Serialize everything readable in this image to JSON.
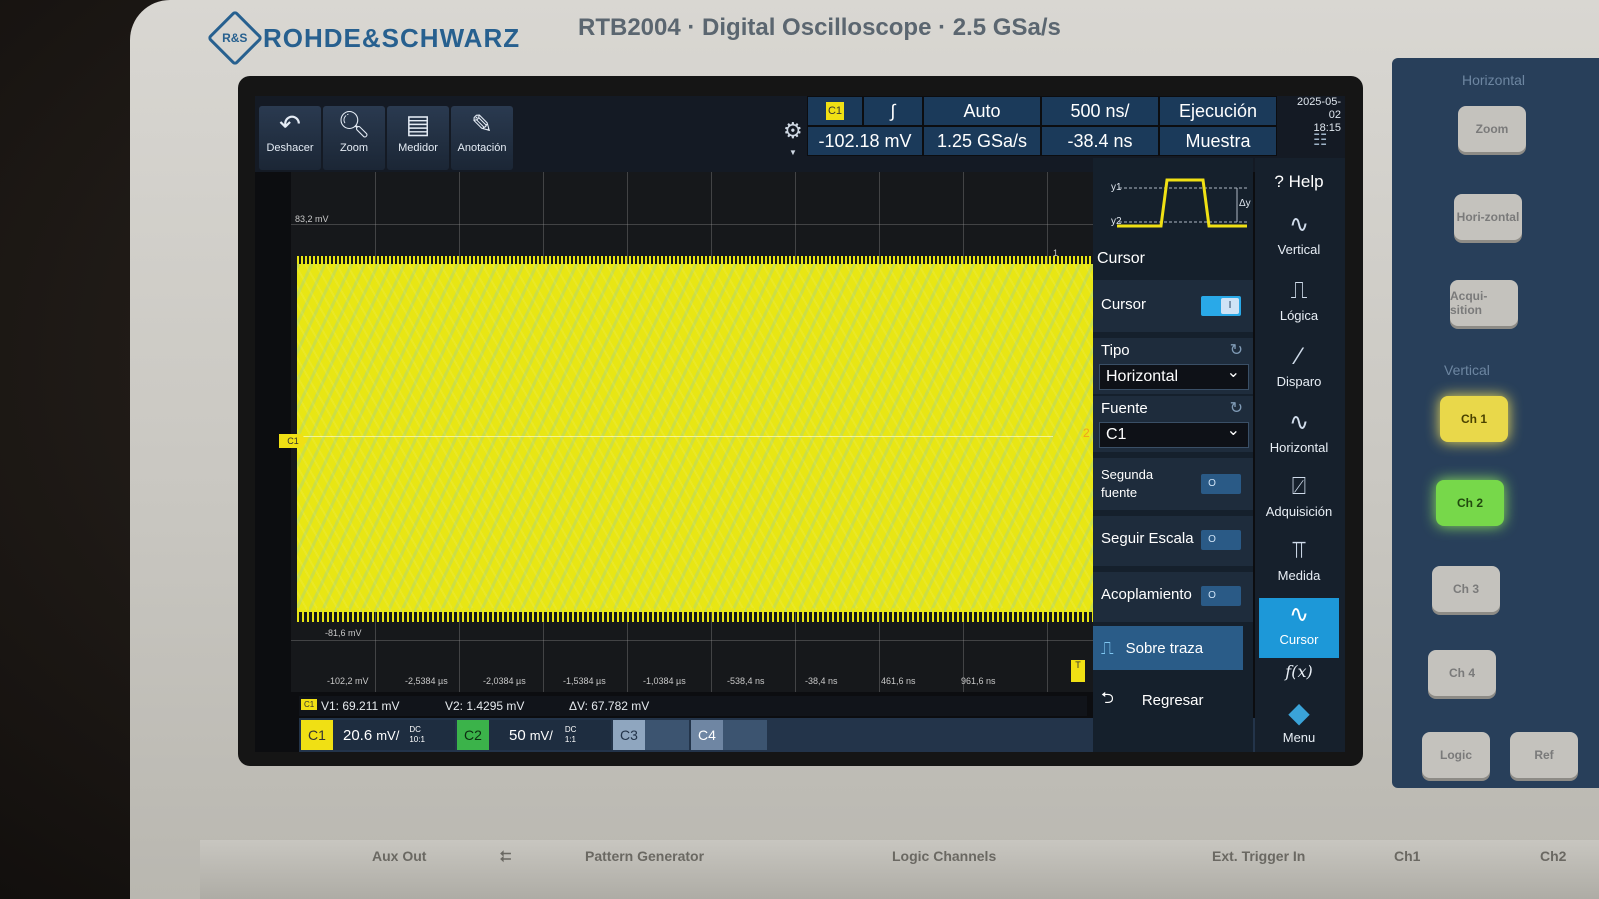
{
  "device": {
    "brand": "ROHDE&SCHWARZ",
    "model": "RTB2004 · Digital Oscilloscope · 2.5 GSa/s"
  },
  "toolbar": {
    "buttons": [
      {
        "label": "Deshacer",
        "icon": "undo-icon"
      },
      {
        "label": "Zoom",
        "icon": "zoom-icon"
      },
      {
        "label": "Medidor",
        "icon": "meter-icon"
      },
      {
        "label": "Anotación",
        "icon": "pencil-icon"
      }
    ]
  },
  "status": {
    "channel": "C1",
    "trigger_level": "-102.18 mV",
    "trigger_mode": "Auto",
    "sample_rate": "1.25 GSa/s",
    "timebase": "500 ns/",
    "time_offset": "-38.4 ns",
    "run_state": "Ejecución",
    "acq_mode": "Muestra",
    "date": "2025-05-02",
    "time": "18:15"
  },
  "plot": {
    "y_top_label": "83,2 mV",
    "y_bottom_label": "-81,6 mV",
    "x_labels": [
      "-102,2 mV",
      "-2,5384 µs",
      "-2,0384 µs",
      "-1,5384 µs",
      "-1,0384 µs",
      "-538,4 ns",
      "-38,4 ns",
      "461,6 ns",
      "961,6 ns"
    ],
    "channel_marker": "C1",
    "cursor2_label": "2",
    "cursor1_label": "1",
    "trigger_marker": "T"
  },
  "measurements": {
    "channel": "C1",
    "v1": "V1: 69.211 mV",
    "v2": "V2: 1.4295 mV",
    "dv": "ΔV: 67.782 mV"
  },
  "channels": [
    {
      "tag": "C1",
      "scale": "20.6",
      "unit": "mV/",
      "coupling": "DC",
      "probe": "10:1",
      "color": "#f0e014"
    },
    {
      "tag": "C2",
      "scale": "50",
      "unit": "mV/",
      "coupling": "DC",
      "probe": "1:1",
      "color": "#3bb34a"
    },
    {
      "tag": "C3",
      "color": "#8fa6bf"
    },
    {
      "tag": "C4",
      "color": "#6f86a3"
    }
  ],
  "cursor_panel": {
    "title": "Cursor",
    "preview_y1": "y1",
    "preview_y2": "y2",
    "preview_dy": "Δy",
    "cursor_label": "Cursor",
    "cursor_on_label": "I",
    "tipo_label": "Tipo",
    "tipo_value": "Horizontal",
    "fuente_label": "Fuente",
    "fuente_value": "C1",
    "segunda_fuente_label": "Segunda fuente",
    "seguir_escala_label": "Seguir Escala",
    "acoplamiento_label": "Acoplamiento",
    "toggle_off_label": "O",
    "sobre_traza_label": "Sobre traza",
    "regresar_label": "Regresar"
  },
  "menu": {
    "help": "? Help",
    "items": [
      {
        "label": "Vertical",
        "icon": "vertical-icon"
      },
      {
        "label": "Lógica",
        "icon": "logic-icon"
      },
      {
        "label": "Disparo",
        "icon": "trigger-icon"
      },
      {
        "label": "Horizontal",
        "icon": "horizontal-icon"
      },
      {
        "label": "Adquisición",
        "icon": "acquisition-icon"
      },
      {
        "label": "Medida",
        "icon": "measure-icon"
      },
      {
        "label": "Cursor",
        "icon": "cursor-icon"
      }
    ],
    "fx": "f(x)",
    "menu_label": "Menu"
  },
  "hardware": {
    "horizontal_section": "Horizontal",
    "vertical_section": "Vertical",
    "zoom": "Zoom",
    "horizontal_btn": "Hori-zontal",
    "acquisition_btn": "Acqui-sition",
    "ch1": "Ch 1",
    "ch2": "Ch 2",
    "ch3": "Ch 3",
    "ch4": "Ch 4",
    "logic": "Logic",
    "ref": "Ref"
  },
  "front_panel": {
    "aux_out": "Aux Out",
    "pattern_generator": "Pattern Generator",
    "logic_channels": "Logic Channels",
    "ext_trigger": "Ext. Trigger In",
    "ch1": "Ch1",
    "ch2": "Ch2"
  }
}
